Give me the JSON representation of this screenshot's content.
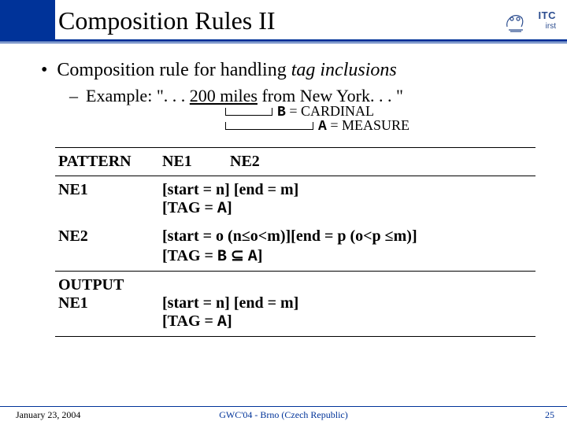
{
  "title": "Composition Rules II",
  "logo": {
    "top": "ITC",
    "bottom": "irst"
  },
  "bullet": {
    "lead": "Composition rule for handling ",
    "italic": "tag inclusions"
  },
  "example": {
    "label": "Example: ",
    "quote_open": "\". . . ",
    "underlined": "200 miles",
    "quote_rest": " from New York. . . \""
  },
  "annot": {
    "b_prefix": "B",
    "b_rest": " = CARDINAL",
    "a_prefix": "A",
    "a_rest": " = MEASURE"
  },
  "table": {
    "header": {
      "c0": "PATTERN",
      "c1": "NE1",
      "c2": "NE2"
    },
    "rows": [
      {
        "c0": "NE1",
        "c1": "[start = n] [end = m]\n[TAG = A]"
      },
      {
        "c0": "NE2",
        "c1": "[start = o (n≤o<m)][end = p (o<p ≤m)]\n[TAG = B ⊆ A]"
      },
      {
        "c0": "OUTPUT\nNE1",
        "c1": "\n[start = n] [end = m]\n[TAG = A]"
      }
    ]
  },
  "footer": {
    "date": "January 23, 2004",
    "center": "GWC'04 - Brno (Czech Republic)",
    "page": "25"
  }
}
